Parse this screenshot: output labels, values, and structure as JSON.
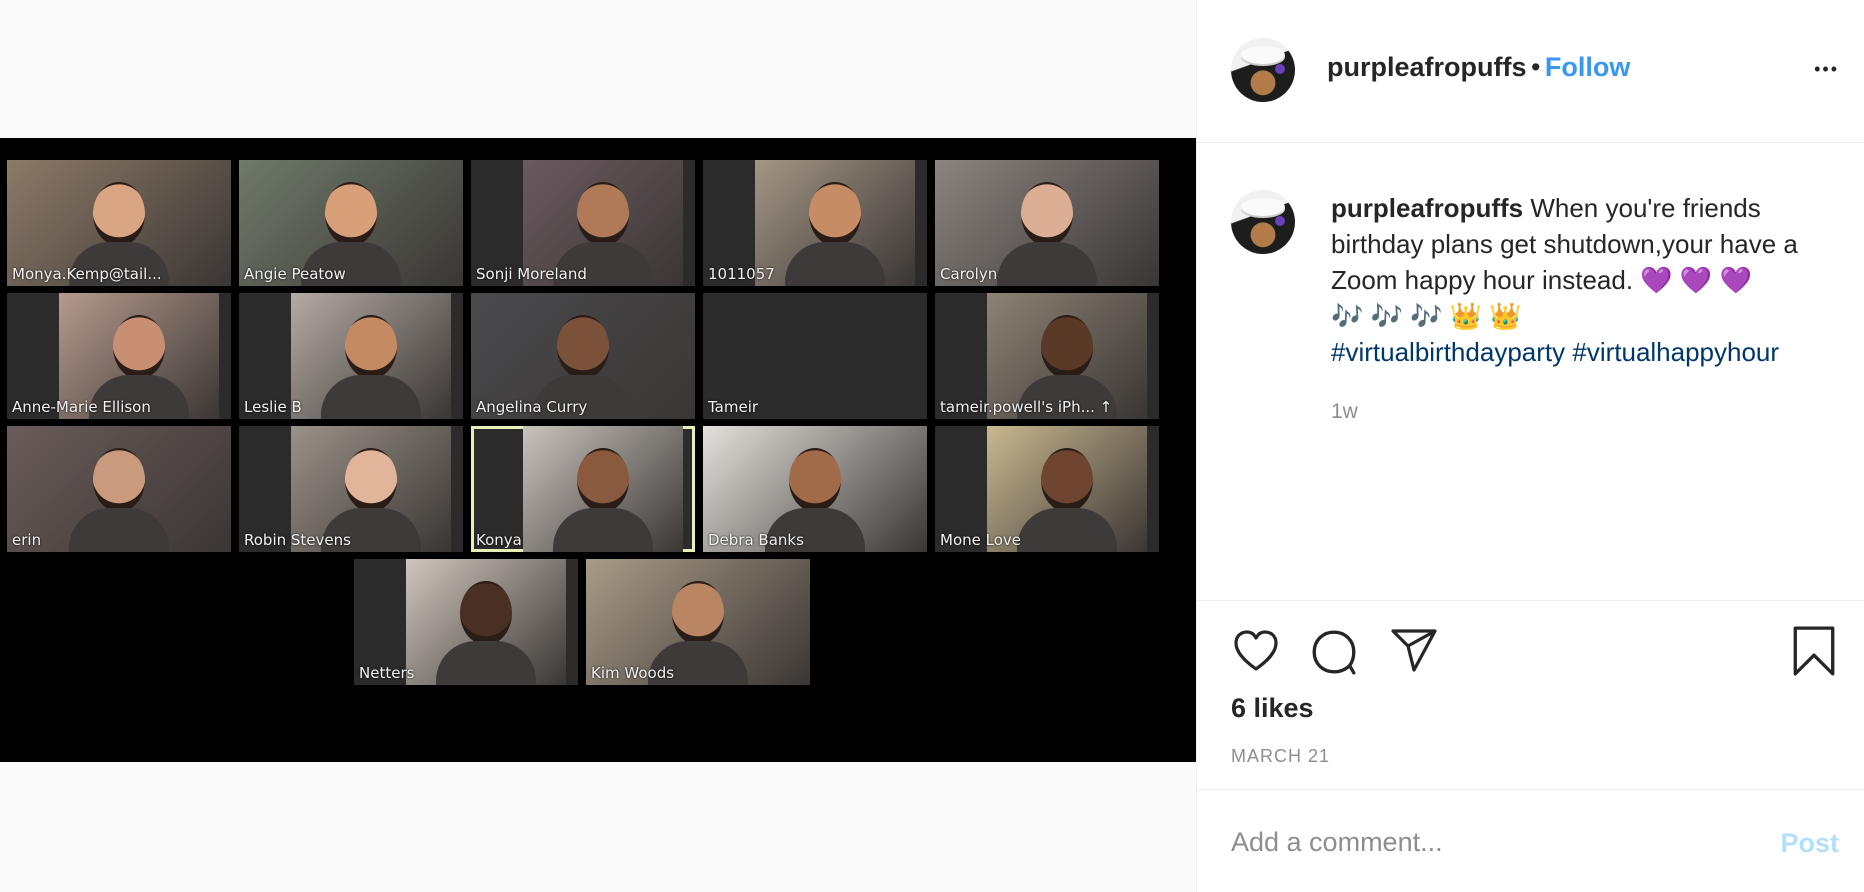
{
  "post": {
    "username": "purpleafropuffs",
    "follow_label": "Follow",
    "separator": "•",
    "more_label": "•••",
    "caption_user": "purpleafropuffs",
    "caption_text": "When you're friends birthday plans get shutdown,your have a Zoom happy hour instead. 💜 💜 💜",
    "caption_line2": "🎶 🎶 🎶 👑 👑",
    "hashtags": [
      "#virtualbirthdayparty",
      "#virtualhappyhour"
    ],
    "time_ago": "1w",
    "likes": "6 likes",
    "date": "MARCH 21",
    "comment_placeholder": "Add a comment...",
    "post_label": "Post"
  },
  "zoom": {
    "participants": [
      {
        "name": "Monya.Kemp@tail...",
        "bg": "#8c7a68",
        "skin": "#d9a583"
      },
      {
        "name": "Angie Peatow",
        "bg": "#6f7a6a",
        "skin": "#d7a079"
      },
      {
        "name": "Sonji Moreland",
        "bg": "#6b5a60",
        "skin": "#b07a59"
      },
      {
        "name": "1011057",
        "bg": "#a39686",
        "skin": "#c58c66"
      },
      {
        "name": "Carolyn",
        "bg": "#8b8480",
        "skin": "#dcae93"
      },
      {
        "name": "Anne-Marie Ellison",
        "bg": "#b59a8e",
        "skin": "#c88f72"
      },
      {
        "name": "Leslie B",
        "bg": "#b4aba3",
        "skin": "#c48b63"
      },
      {
        "name": "Angelina Curry",
        "bg": "#4a4a4d",
        "skin": "#7a5239"
      },
      {
        "name": "Tameir",
        "bg": "#2b2b2b",
        "skin": ""
      },
      {
        "name": "tameir.powell's iPh... ↑",
        "bg": "#8d8375",
        "skin": "#5a3a26"
      },
      {
        "name": "erin",
        "bg": "#6a5c5a",
        "skin": "#c99a7e"
      },
      {
        "name": "Robin Stevens",
        "bg": "#9a9288",
        "skin": "#e1b59a"
      },
      {
        "name": "Konya",
        "bg": "#c9c3bd",
        "skin": "#8a5a3e"
      },
      {
        "name": "Debra Banks",
        "bg": "#e4e1dc",
        "skin": "#a16b4a"
      },
      {
        "name": "Mone Love",
        "bg": "#c9b890",
        "skin": "#6e4530"
      },
      {
        "name": "Netters",
        "bg": "#cfc7bd",
        "skin": "#4a3024"
      },
      {
        "name": "Kim Woods",
        "bg": "#a99b88",
        "skin": "#b98563"
      }
    ]
  },
  "colors": {
    "follow": "#3897f0",
    "hashtag": "#00376b",
    "post_disabled": "#b2dffc",
    "active_speaker": "#e8efb8"
  }
}
